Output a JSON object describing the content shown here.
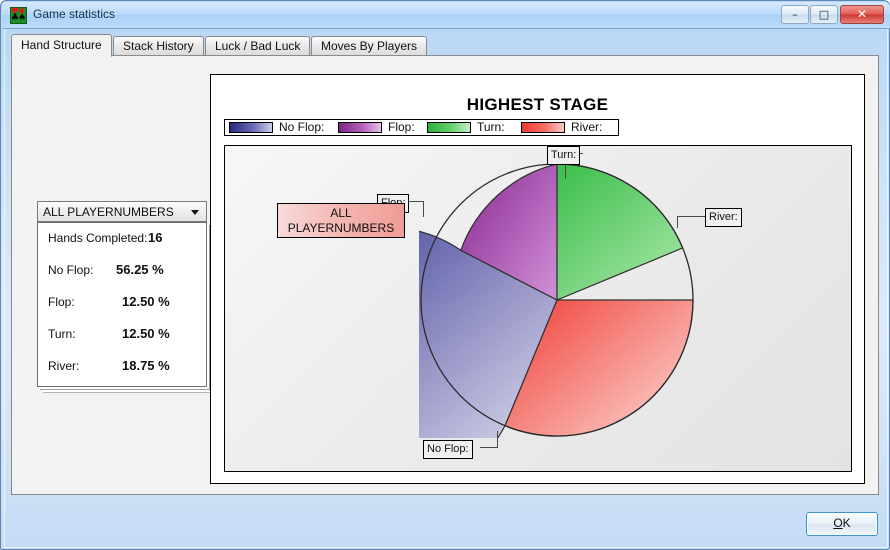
{
  "window": {
    "title": "Game statistics",
    "icon": "playing-card-suits-icon",
    "controls": {
      "minimize": "–",
      "maximize": "□",
      "close": "✕"
    }
  },
  "tabs": [
    {
      "label": "Hand Structure",
      "selected": true
    },
    {
      "label": "Stack History",
      "selected": false
    },
    {
      "label": "Luck / Bad Luck",
      "selected": false
    },
    {
      "label": "Moves By Players",
      "selected": false
    }
  ],
  "stats_panel": {
    "selector_value": "ALL PLAYERNUMBERS",
    "rows": [
      {
        "label": "Hands Completed:",
        "value": "16"
      },
      {
        "label": "No Flop:",
        "value": "56.25 %"
      },
      {
        "label": "Flop:",
        "value": "12.50 %"
      },
      {
        "label": "Turn:",
        "value": "12.50 %"
      },
      {
        "label": "River:",
        "value": "18.75 %"
      }
    ]
  },
  "chart_data": {
    "type": "pie",
    "title": "HIGHEST STAGE",
    "labels": [
      "No Flop:",
      "Flop:",
      "Turn:",
      "River:"
    ],
    "values": [
      56.25,
      12.5,
      12.5,
      18.75
    ],
    "unit": "%",
    "total_hands": 16,
    "legend_position": "top",
    "legend_entries": [
      {
        "label": "No Flop:",
        "color": "#3a3a96"
      },
      {
        "label": "Flop:",
        "color": "#8e2f96"
      },
      {
        "label": "Turn:",
        "color": "#3fc04f"
      },
      {
        "label": "River:",
        "color": "#f24a42"
      }
    ],
    "slices": [
      {
        "name": "River:",
        "value": 18.75,
        "color_dark": "#f04a42",
        "color_light": "#fbc3bf",
        "start_deg": 0,
        "end_deg": 67.5
      },
      {
        "name": "No Flop:",
        "value": 56.25,
        "color_dark": "#3a3a96",
        "color_light": "#d6d4ea",
        "start_deg": 67.5,
        "end_deg": 270.0
      },
      {
        "name": "Flop:",
        "value": 12.5,
        "color_dark": "#8e2f96",
        "color_light": "#cf8fd6",
        "start_deg": 270.0,
        "end_deg": 315.0
      },
      {
        "name": "Turn:",
        "value": 12.5,
        "color_dark": "#3fc04f",
        "color_light": "#abe8a8",
        "start_deg": 315.0,
        "end_deg": 360.0
      }
    ],
    "annotations": [
      {
        "text": "Turn:"
      },
      {
        "text": "Flop:"
      },
      {
        "text": "River:"
      },
      {
        "text": "No Flop:"
      },
      {
        "text": "ALL PLAYERNUMBERS"
      }
    ]
  },
  "callouts": {
    "turn": "Turn:",
    "flop": "Flop:",
    "river": "River:",
    "no_flop": "No Flop:",
    "all_players_line1": "ALL",
    "all_players_line2": "PLAYERNUMBERS"
  },
  "footer": {
    "ok_label": "OK",
    "ok_accel": "O",
    "ok_rest": "K"
  }
}
